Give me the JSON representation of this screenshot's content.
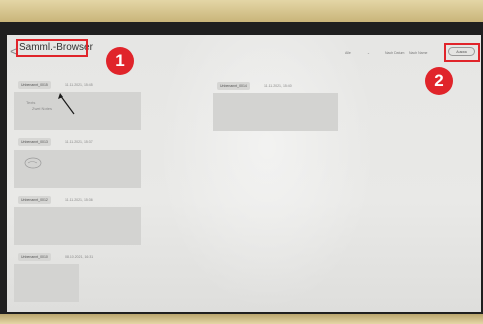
{
  "header": {
    "title": "Samml.-Browser",
    "back_symbol": "<",
    "filter_select": "Alle",
    "filter_caret": "⌄",
    "sort_old": "Nach Datum",
    "sort_new": "Nach Name",
    "select_button": "Auswa"
  },
  "annotations": {
    "badge_1": "1",
    "badge_2": "2",
    "highlight_color": "#e0242a"
  },
  "collections": [
    {
      "name": "Unbenannt_0015",
      "date": "11.11.2021, 15:45"
    },
    {
      "name": "Unbenannt_0014",
      "date": "11.11.2021, 15:40"
    },
    {
      "name": "Unbenannt_0013",
      "date": "11.11.2021, 15:37"
    },
    {
      "name": "Unbenannt_0012",
      "date": "11.11.2021, 15:36"
    },
    {
      "name": "Unbenannt_0010",
      "date": "08.10.2021, 16:31"
    }
  ],
  "sketch_text": {
    "line1": "Texts",
    "line2": "Zwei Notes"
  }
}
